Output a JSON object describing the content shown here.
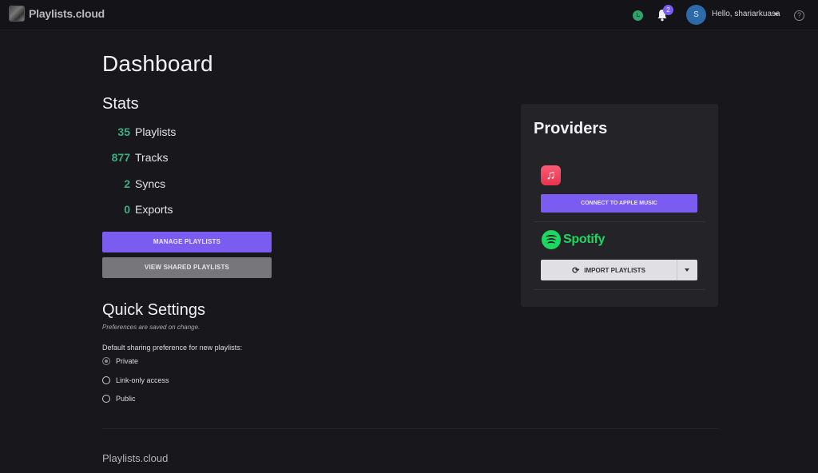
{
  "header": {
    "brand": "Playlists.cloud",
    "notification_count": "2",
    "avatar_initial": "S",
    "greeting": "Hello, shariarkuasa",
    "help_glyph": "?",
    "icons": [
      "logo-icon",
      "clock-icon",
      "bell-icon",
      "chevron-down-icon",
      "help-icon"
    ]
  },
  "page": {
    "title": "Dashboard"
  },
  "stats": {
    "title": "Stats",
    "items": [
      {
        "value": "35",
        "label": "Playlists"
      },
      {
        "value": "877",
        "label": "Tracks"
      },
      {
        "value": "2",
        "label": "Syncs"
      },
      {
        "value": "0",
        "label": "Exports"
      }
    ],
    "manage_button": "MANAGE PLAYLISTS",
    "shared_button": "VIEW SHARED PLAYLISTS"
  },
  "quick_settings": {
    "title": "Quick Settings",
    "note": "Preferences are saved on change.",
    "sharing_label": "Default sharing preference for new playlists:",
    "options": [
      {
        "label": "Private",
        "checked": true
      },
      {
        "label": "Link-only access",
        "checked": false
      },
      {
        "label": "Public",
        "checked": false
      }
    ]
  },
  "providers": {
    "title": "Providers",
    "apple": {
      "glyph": "♫",
      "button": "CONNECT TO APPLE MUSIC"
    },
    "spotify": {
      "name": "Spotify",
      "button": "IMPORT PLAYLISTS",
      "sync_glyph": "⟳"
    }
  },
  "footer": {
    "brand": "Playlists.cloud"
  },
  "colors": {
    "accent": "#7b5cf0",
    "stat_number": "#3fae7f",
    "spotify_green": "#1ed760",
    "background": "#17171c",
    "card": "#242428"
  }
}
